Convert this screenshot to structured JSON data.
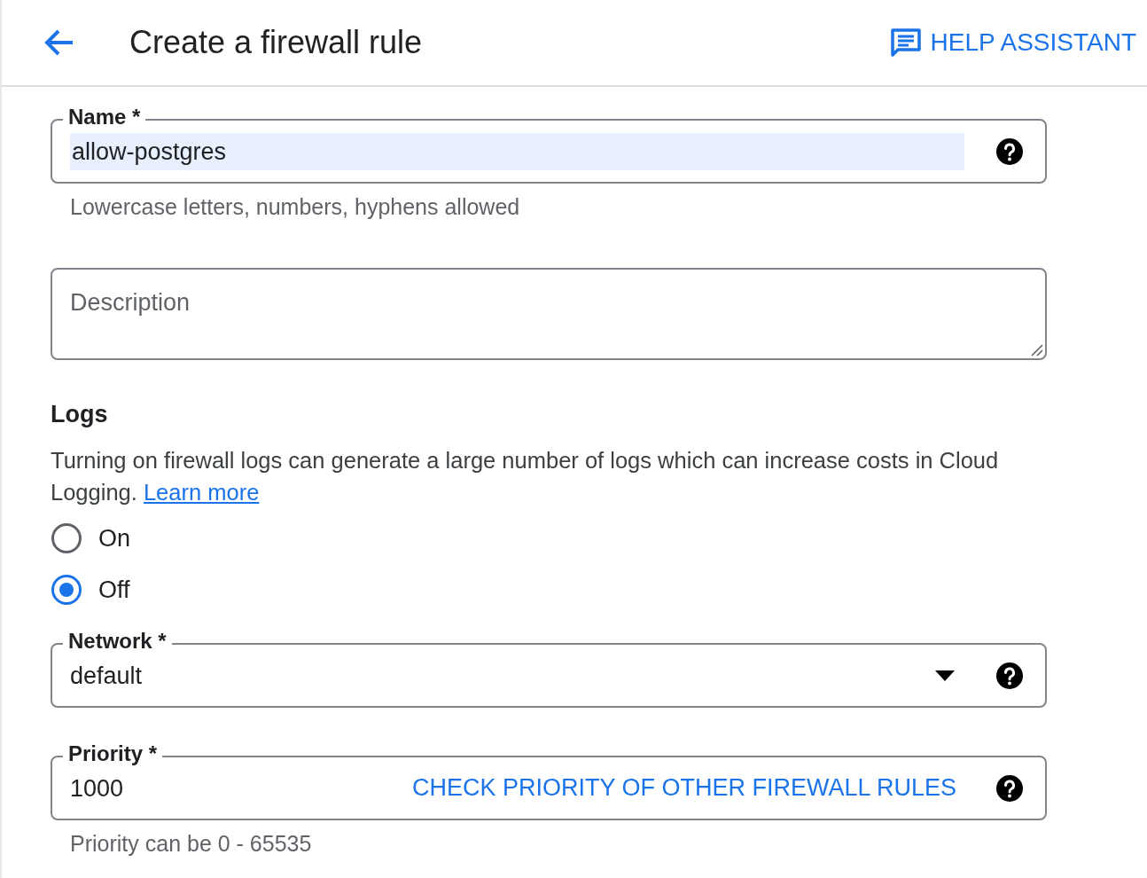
{
  "header": {
    "title": "Create a firewall rule",
    "help_button": "HELP ASSISTANT"
  },
  "name_field": {
    "label": "Name *",
    "value": "allow-postgres",
    "value_highlighted": true,
    "hint": "Lowercase letters, numbers, hyphens allowed"
  },
  "description_field": {
    "placeholder": "Description"
  },
  "logs": {
    "heading": "Logs",
    "text": "Turning on firewall logs can generate a large number of logs which can increase costs in Cloud Logging.",
    "link": "Learn more",
    "options": [
      {
        "label": "On",
        "selected": false
      },
      {
        "label": "Off",
        "selected": true
      }
    ]
  },
  "network_field": {
    "label": "Network *",
    "value": "default"
  },
  "priority_field": {
    "label": "Priority *",
    "value": "1000",
    "action": "CHECK PRIORITY OF OTHER FIREWALL RULES",
    "hint": "Priority can be 0 - 65535"
  }
}
